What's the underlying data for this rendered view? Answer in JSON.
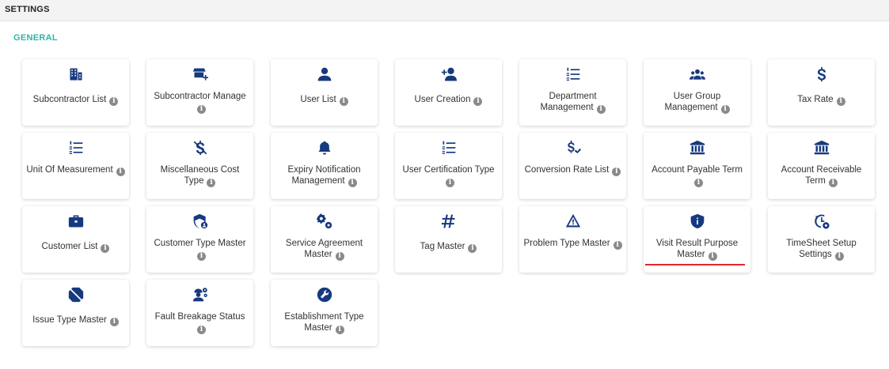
{
  "header": {
    "title": "SETTINGS"
  },
  "section": {
    "title": "GENERAL"
  },
  "accent": "#2cb5a8",
  "icon_color": "#16397f",
  "cards": [
    {
      "label": "Subcontractor List",
      "icon": "building-icon",
      "lines": 1
    },
    {
      "label": "Subcontractor Manage",
      "icon": "store-plus-icon",
      "lines": 2
    },
    {
      "label": "User List",
      "icon": "user-icon",
      "lines": 1
    },
    {
      "label": "User Creation",
      "icon": "user-plus-icon",
      "lines": 1
    },
    {
      "label": "Department Management",
      "icon": "numbered-list-icon",
      "lines": 2
    },
    {
      "label": "User Group Management",
      "icon": "users-group-icon",
      "lines": 2
    },
    {
      "label": "Tax Rate",
      "icon": "dollar-icon",
      "lines": 1
    },
    {
      "label": "Unit Of Measurement",
      "icon": "numbered-list-icon",
      "lines": 2
    },
    {
      "label": "Miscellaneous Cost Type",
      "icon": "dollar-slash-icon",
      "lines": 2
    },
    {
      "label": "Expiry Notification Management",
      "icon": "bell-icon",
      "lines": 2
    },
    {
      "label": "User Certification Type",
      "icon": "numbered-list-icon",
      "lines": 2
    },
    {
      "label": "Conversion Rate List",
      "icon": "dollar-check-icon",
      "lines": 2
    },
    {
      "label": "Account Payable Term",
      "icon": "bank-icon",
      "lines": 2
    },
    {
      "label": "Account Receivable Term",
      "icon": "bank-icon",
      "lines": 2
    },
    {
      "label": "Customer List",
      "icon": "briefcase-icon",
      "lines": 1
    },
    {
      "label": "Customer Type Master",
      "icon": "shield-user-icon",
      "lines": 2
    },
    {
      "label": "Service Agreement Master",
      "icon": "gears-icon",
      "lines": 2
    },
    {
      "label": "Tag Master",
      "icon": "hashtag-icon",
      "lines": 1
    },
    {
      "label": "Problem Type Master",
      "icon": "warning-triangle-icon",
      "lines": 2
    },
    {
      "label": "Visit Result Purpose Master",
      "icon": "shield-info-icon",
      "lines": 2
    },
    {
      "label": "TimeSheet Setup Settings",
      "icon": "clock-gear-icon",
      "lines": 2
    },
    {
      "label": "Issue Type Master",
      "icon": "ban-icon",
      "lines": 1
    },
    {
      "label": "Fault Breakage Status",
      "icon": "worker-gear-icon",
      "lines": 2
    },
    {
      "label": "Establishment Type Master",
      "icon": "wrench-icon",
      "lines": 2
    }
  ]
}
